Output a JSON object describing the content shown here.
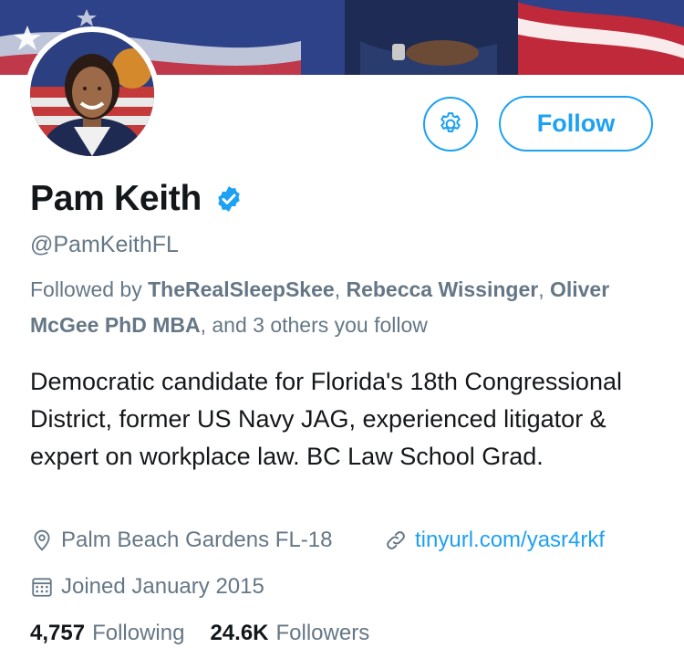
{
  "profile": {
    "name": "Pam Keith",
    "handle": "@PamKeithFL",
    "followed_by": {
      "prefix": "Followed by",
      "names": [
        "TheRealSleepSkee",
        "Rebecca Wissinger",
        "Oliver McGee PhD MBA"
      ],
      "suffix": ", and 3 others you follow"
    },
    "bio": "Democratic candidate for Florida's 18th Congressional District, former US Navy JAG, experienced litigator & expert on workplace law. BC Law School Grad.",
    "location": "Palm Beach Gardens FL-18",
    "website": "tinyurl.com/yasr4rkf",
    "joined": "Joined January 2015",
    "following_count": "4,757",
    "following_label": "Following",
    "followers_count": "24.6K",
    "followers_label": "Followers"
  },
  "actions": {
    "follow_label": "Follow",
    "settings_icon": "gear-icon"
  },
  "icons": {
    "verified": "verified-badge-icon",
    "location": "location-pin-icon",
    "link": "link-icon",
    "calendar": "calendar-icon"
  },
  "colors": {
    "accent": "#1da1f2",
    "secondary_text": "#657786",
    "primary_text": "#14171a"
  }
}
